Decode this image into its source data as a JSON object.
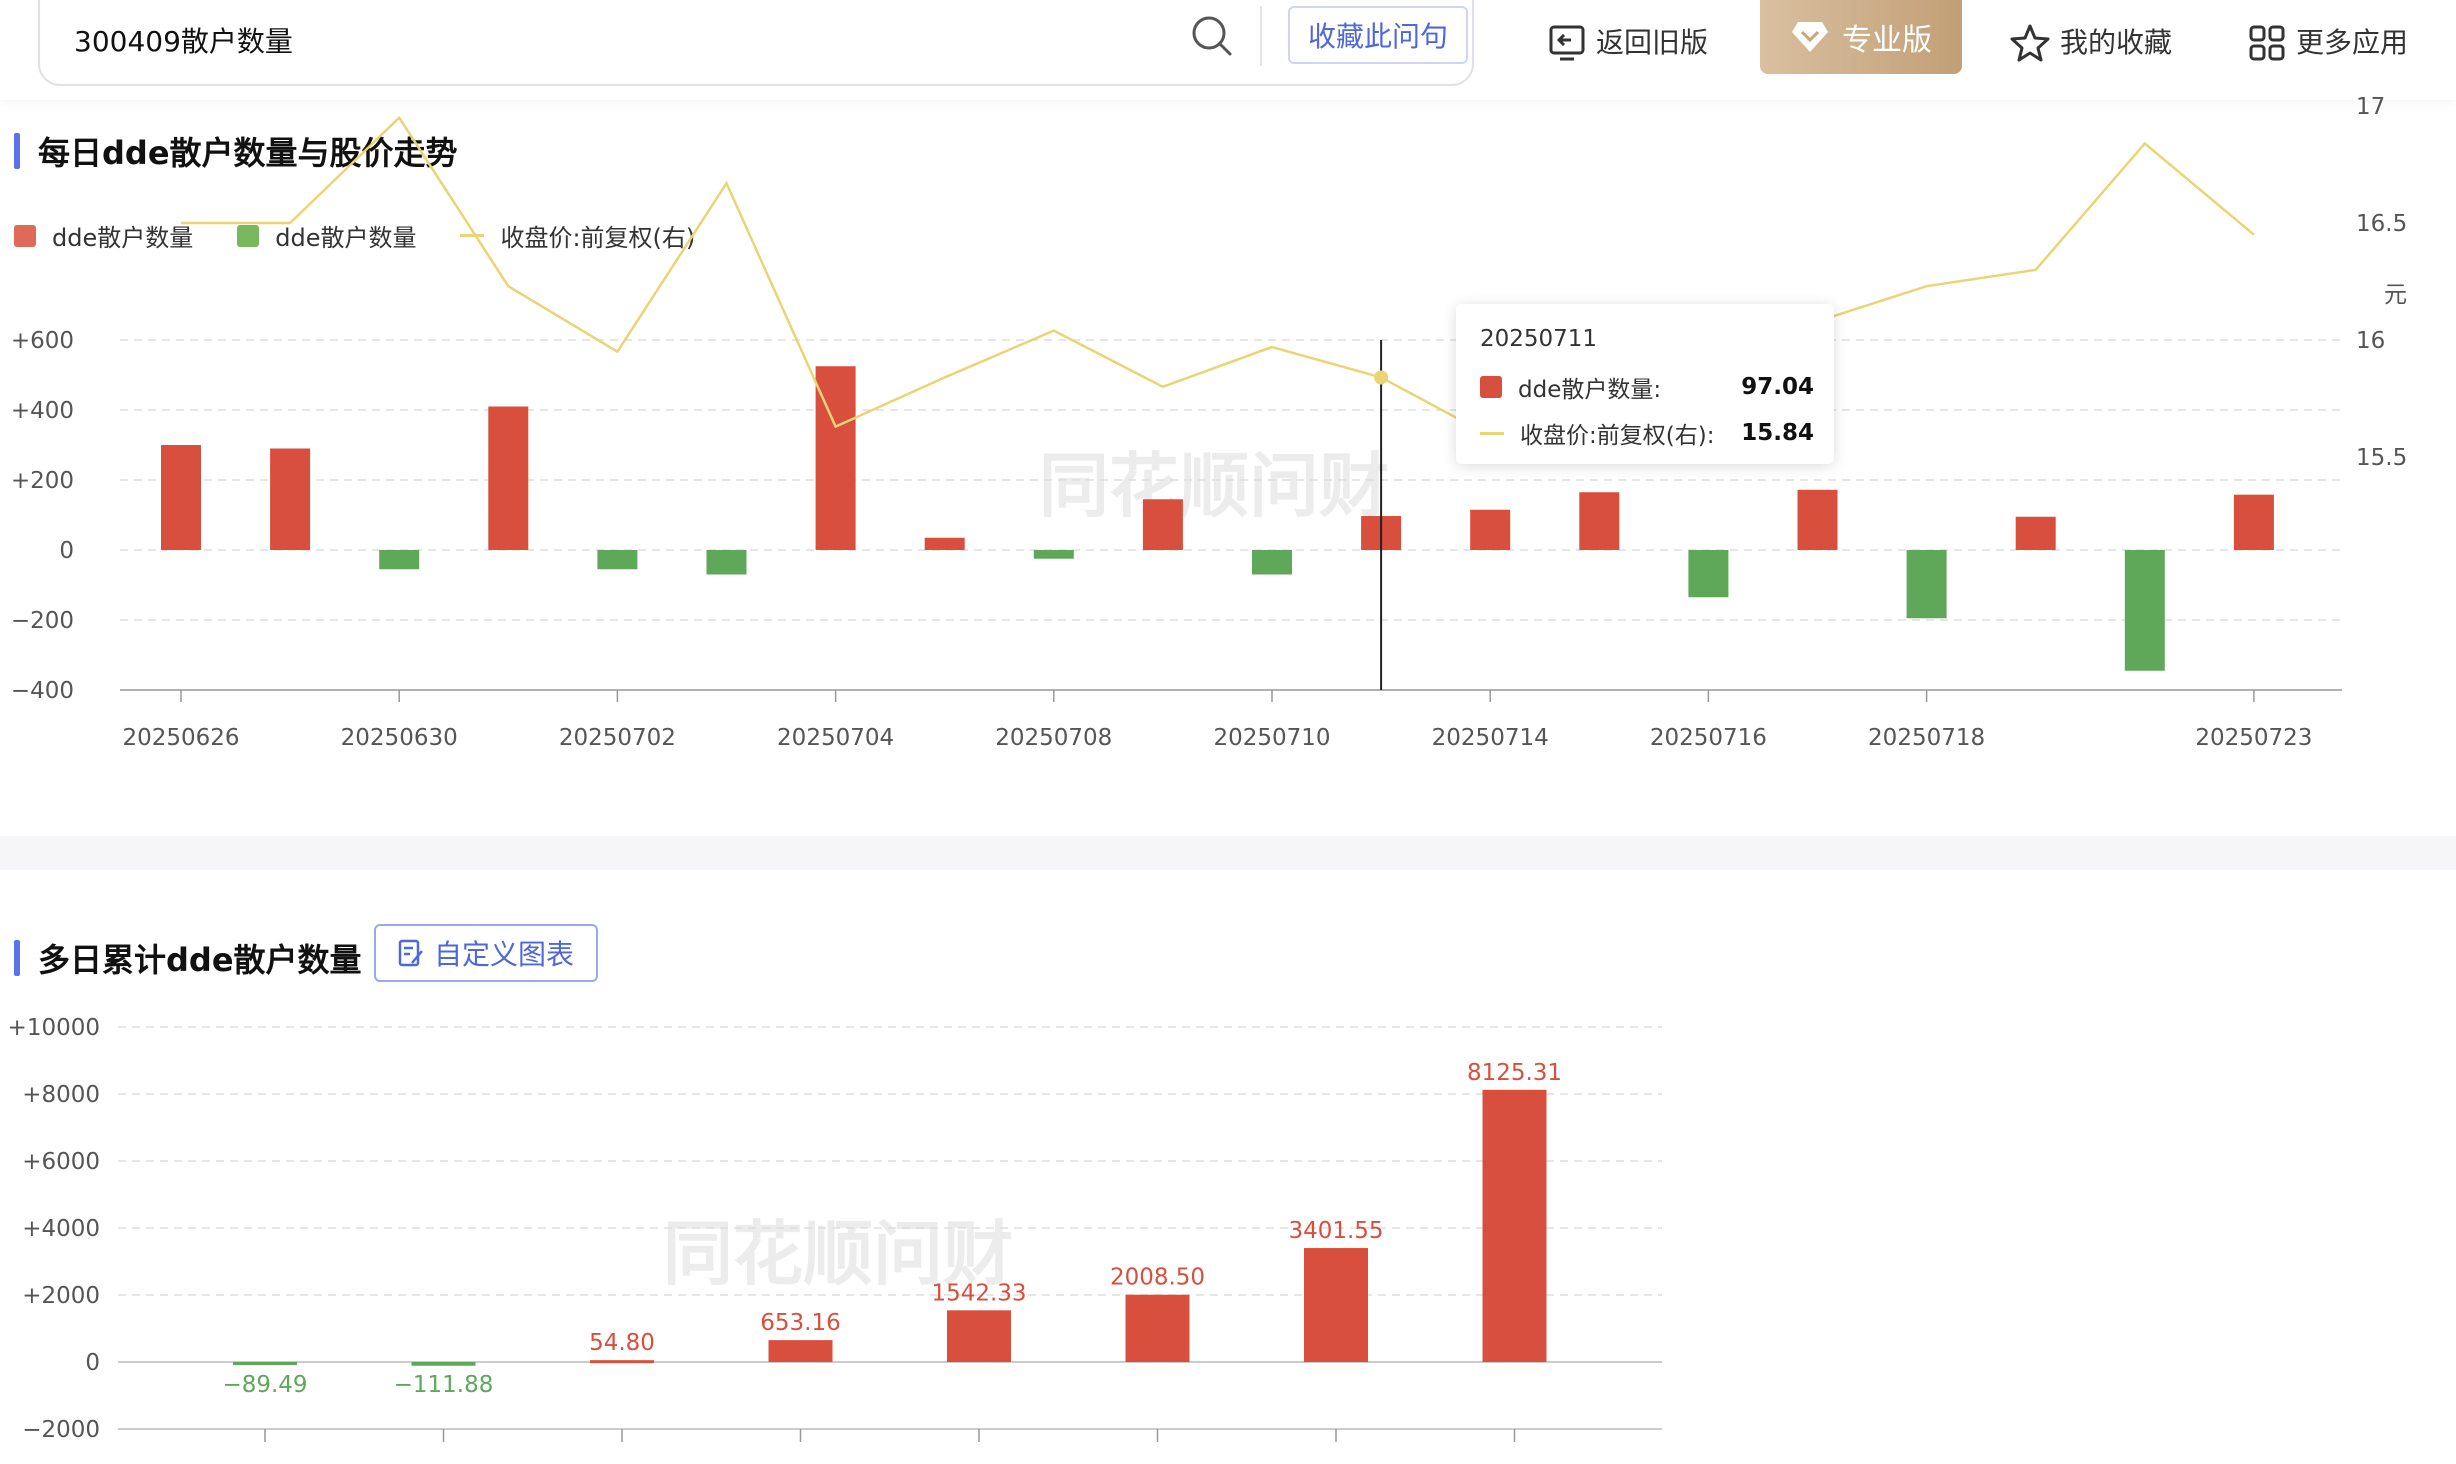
{
  "header": {
    "search_value": "300409散户数量",
    "fav_label": "收藏此问句",
    "back_label": "返回旧版",
    "pro_label": "专业版",
    "mine_label": "我的收藏",
    "more_label": "更多应用",
    "icons": [
      "search-icon",
      "return-icon",
      "diamond-icon",
      "star-icon",
      "apps-icon"
    ]
  },
  "daily": {
    "title": "每日dde散户数量与股价走势",
    "legend": [
      {
        "label": "dde散户数量",
        "color": "#e06a5a",
        "type": "rect"
      },
      {
        "label": "dde散户数量",
        "color": "#79b85f",
        "type": "rect"
      },
      {
        "label": "收盘价:前复权(右)",
        "color": "#ead475",
        "type": "line"
      }
    ],
    "watermark": "同花顺问财",
    "right_unit": "元",
    "tooltip": {
      "date": "20250711",
      "rows": [
        {
          "label": "dde散户数量:",
          "value": "97.04",
          "color": "#d94f3d"
        },
        {
          "label": "收盘价:前复权(右):",
          "value": "15.84",
          "color": "#ead475"
        }
      ]
    }
  },
  "cumulative": {
    "title": "多日累计dde散户数量",
    "custom_label": "自定义图表",
    "watermark": "同花顺问财"
  },
  "colors": {
    "positive": "#d94f3d",
    "negative": "#5fa85a",
    "line": "#ead475",
    "accent": "#5b73e8"
  },
  "chart_data": [
    {
      "type": "bar",
      "title": "每日dde散户数量与股价走势",
      "categories": [
        "20250626",
        "20250627",
        "20250630",
        "20250701",
        "20250702",
        "20250703",
        "20250704",
        "20250707",
        "20250708",
        "20250709",
        "20250710",
        "20250711",
        "20250714",
        "20250715",
        "20250716",
        "20250717",
        "20250718",
        "20250721",
        "20250722",
        "20250723"
      ],
      "series": [
        {
          "name": "dde散户数量",
          "type": "bar",
          "axis": "left",
          "values": [
            300,
            290,
            -55,
            410,
            -55,
            -70,
            525,
            35,
            -25,
            145,
            -70,
            97.04,
            115,
            165,
            -135,
            172,
            -195,
            95,
            -345,
            158
          ]
        },
        {
          "name": "收盘价:前复权(右)",
          "type": "line",
          "axis": "right",
          "values": [
            16.5,
            16.5,
            16.95,
            16.23,
            15.95,
            16.67,
            15.63,
            15.84,
            16.04,
            15.8,
            15.97,
            15.84,
            15.59,
            15.58,
            15.93,
            16.08,
            16.23,
            16.3,
            16.84,
            16.45
          ]
        }
      ],
      "x_tick_labels": [
        "20250626",
        "20250630",
        "20250702",
        "20250704",
        "20250708",
        "20250710",
        "20250714",
        "20250716",
        "20250718",
        "20250723"
      ],
      "y_left_ticks": [
        "+600",
        "+400",
        "+200",
        "0",
        "−200",
        "−400"
      ],
      "y_left_range": [
        -400,
        600
      ],
      "y_right_ticks": [
        "17",
        "16.5",
        "16",
        "15.5"
      ],
      "y_right_range": [
        15.5,
        17
      ],
      "grid": true,
      "legend_position": "top-left"
    },
    {
      "type": "bar",
      "title": "多日累计dde散户数量",
      "categories": [
        "",
        "",
        "",
        "",
        "",
        "",
        "",
        ""
      ],
      "values": [
        -89.49,
        -111.88,
        54.8,
        653.16,
        1542.33,
        2008.5,
        3401.55,
        8125.31
      ],
      "data_labels": [
        "−89.49",
        "−111.88",
        "54.80",
        "653.16",
        "1542.33",
        "2008.50",
        "3401.55",
        "8125.31"
      ],
      "y_ticks": [
        "+10000",
        "+8000",
        "+6000",
        "+4000",
        "+2000",
        "0",
        "−2000"
      ],
      "y_range": [
        -2000,
        10000
      ],
      "grid": true
    }
  ]
}
